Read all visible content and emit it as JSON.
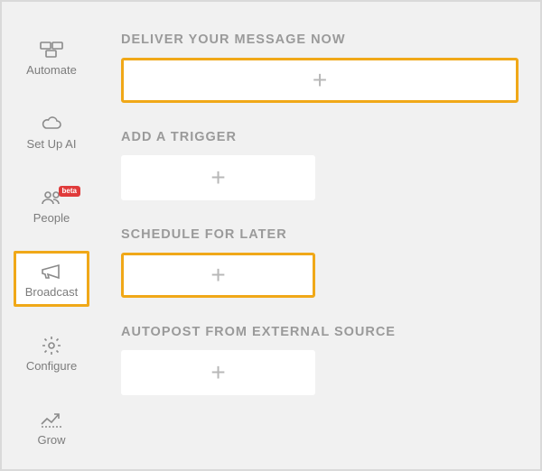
{
  "sidebar": {
    "items": [
      {
        "label": "Automate"
      },
      {
        "label": "Set Up AI"
      },
      {
        "label": "People",
        "badge": "beta"
      },
      {
        "label": "Broadcast"
      },
      {
        "label": "Configure"
      },
      {
        "label": "Grow"
      }
    ]
  },
  "sections": {
    "deliver": {
      "title": "DELIVER YOUR MESSAGE NOW"
    },
    "trigger": {
      "title": "ADD A TRIGGER"
    },
    "schedule": {
      "title": "SCHEDULE FOR LATER"
    },
    "autopost": {
      "title": "AUTOPOST FROM EXTERNAL SOURCE"
    }
  },
  "plus": "+"
}
